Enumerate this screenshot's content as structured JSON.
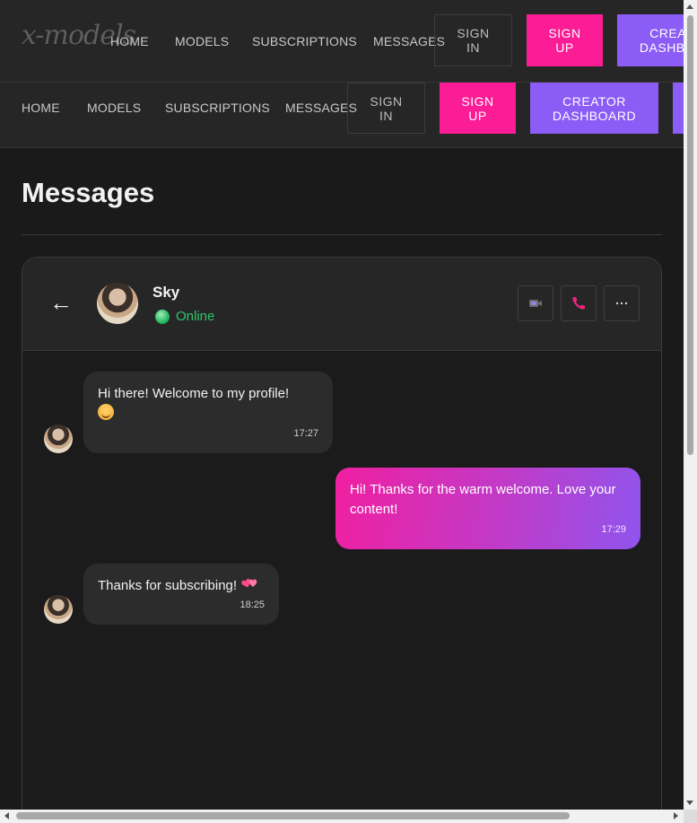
{
  "header": {
    "logo": "x-models",
    "nav": [
      "HOME",
      "MODELS",
      "SUBSCRIPTIONS",
      "MESSAGES"
    ],
    "sign_in": "SIGN IN",
    "sign_up": "SIGN UP",
    "creator_dashboard": "CREATOR DASHBOARD"
  },
  "page": {
    "title": "Messages"
  },
  "chat": {
    "back_icon": "arrow-left-icon",
    "contact": {
      "name": "Sky",
      "status": "Online"
    },
    "actions": [
      "video-call-icon",
      "phone-icon",
      "more-icon"
    ],
    "messages": [
      {
        "from": "them",
        "text": "Hi there! Welcome to my profile!",
        "emoji": "smile-emoji",
        "time": "17:27"
      },
      {
        "from": "me",
        "text": "Hi! Thanks for the warm welcome. Love your content!",
        "time": "17:29"
      },
      {
        "from": "them",
        "text": "Thanks for subscribing!",
        "emoji": "two-hearts-emoji",
        "time": "18:25"
      }
    ]
  },
  "colors": {
    "accent_pink": "#fc1c95",
    "accent_purple": "#8b5cf6",
    "online_green": "#2ec56a",
    "background": "#1a1a1b"
  }
}
